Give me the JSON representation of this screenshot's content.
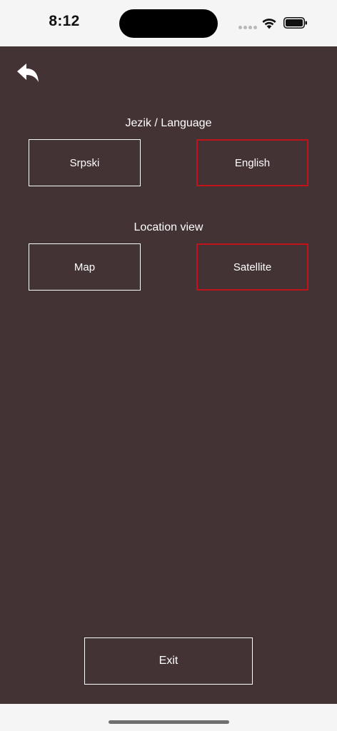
{
  "status_bar": {
    "time": "8:12"
  },
  "icons": {
    "back": "back-arrow-icon",
    "wifi": "wifi-icon",
    "battery": "battery-icon",
    "signal": "signal-dots-icon"
  },
  "language_section": {
    "title": "Jezik / Language",
    "options": [
      {
        "label": "Srpski",
        "selected": false
      },
      {
        "label": "English",
        "selected": true
      }
    ]
  },
  "location_section": {
    "title": "Location view",
    "options": [
      {
        "label": "Map",
        "selected": false
      },
      {
        "label": "Satellite",
        "selected": true
      }
    ]
  },
  "exit_label": "Exit",
  "colors": {
    "background": "#443334",
    "selected_border": "#c0141a",
    "default_border": "#ffffff",
    "text": "#ffffff"
  }
}
